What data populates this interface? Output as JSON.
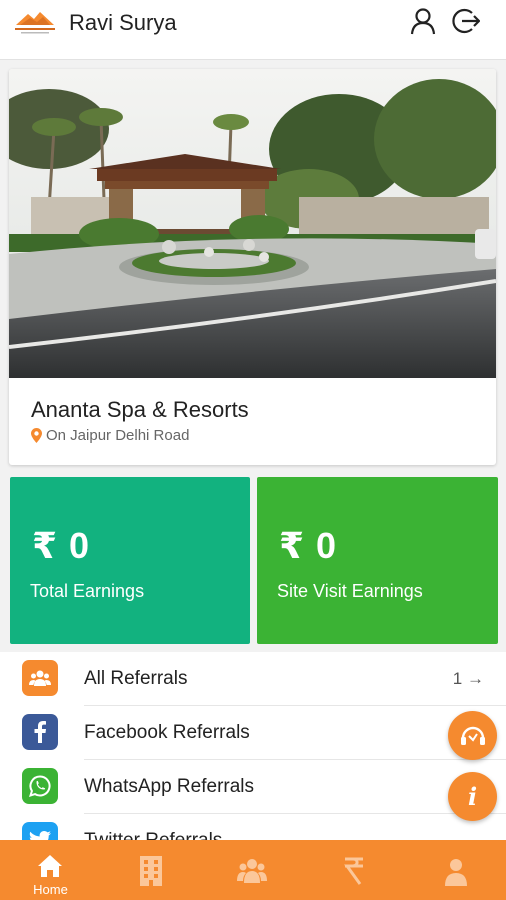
{
  "header": {
    "user_name": "Ravi Surya",
    "logo_icon": "resort-logo",
    "profile_icon": "user-outline-icon",
    "logout_icon": "logout-icon"
  },
  "property": {
    "name": "Ananta Spa & Resorts",
    "location": "On Jaipur Delhi Road",
    "location_icon": "map-pin-icon"
  },
  "earnings": [
    {
      "amount": "₹ 0",
      "label": "Total Earnings",
      "color": "#12b27f"
    },
    {
      "amount": "₹ 0",
      "label": "Site Visit Earnings",
      "color": "#3bb334"
    }
  ],
  "referrals": [
    {
      "label": "All Referrals",
      "icon": "group-icon",
      "icon_color": "#f58a2f",
      "count": "1",
      "arrow": "→"
    },
    {
      "label": "Facebook Referrals",
      "icon": "facebook-icon",
      "icon_color": "#3b5998",
      "count": "",
      "arrow": ""
    },
    {
      "label": "WhatsApp Referrals",
      "icon": "whatsapp-icon",
      "icon_color": "#3bb334",
      "count": "",
      "arrow": ""
    },
    {
      "label": "Twitter Referrals",
      "icon": "twitter-icon",
      "icon_color": "#1da1f2",
      "count": "",
      "arrow": "→"
    }
  ],
  "fabs": [
    {
      "icon": "support-icon"
    },
    {
      "icon": "info-icon",
      "glyph": "i"
    }
  ],
  "bottom_nav": [
    {
      "label": "Home",
      "icon": "home-icon",
      "active": true
    },
    {
      "label": "",
      "icon": "building-icon",
      "active": false
    },
    {
      "label": "",
      "icon": "group-icon",
      "active": false
    },
    {
      "label": "",
      "icon": "rupee-icon",
      "active": false
    },
    {
      "label": "",
      "icon": "person-icon",
      "active": false
    }
  ],
  "colors": {
    "accent": "#f58a2f",
    "total_earnings": "#12b27f",
    "site_visit_earnings": "#3bb334",
    "facebook": "#3b5998",
    "whatsapp": "#3bb334",
    "twitter": "#1da1f2"
  }
}
